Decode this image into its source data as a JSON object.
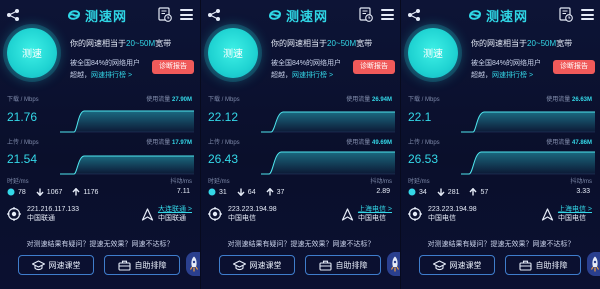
{
  "app": {
    "logo_text": "测速网",
    "brand_color": "#2fd7e6",
    "accent_red": "#f05a5a"
  },
  "common": {
    "start_label": "测速",
    "hero_prefix": "你的网速相当于",
    "hero_range": "20~50M",
    "hero_suffix": "宽带",
    "beat_text": "被全国84%的网络用户",
    "rank_prefix": "超越，",
    "rank_link": "网速排行榜 >",
    "report_label": "诊断报告",
    "download_label": "下载 / Mbps",
    "usage_label": "使用流量",
    "upload_label": "上传 / Mbps",
    "latency_label": "时延/ms",
    "jitter_label": "抖动/ms",
    "question_text": "对测速结果有疑问？提速无效果？网速不达标？",
    "course_label": "网速课堂",
    "fix_label": "自助排障"
  },
  "panels": [
    {
      "download": "21.76",
      "download_usage": "27.90M",
      "upload": "21.54",
      "upload_usage": "17.97M",
      "lat_a": "78",
      "lat_b": "1067",
      "lat_c": "1176",
      "jitter": "7.11",
      "ip": "221.216.117.133",
      "isp": "中国联通",
      "server": "大连联通 >",
      "server_isp": "中国联通"
    },
    {
      "download": "22.12",
      "download_usage": "26.94M",
      "upload": "26.43",
      "upload_usage": "49.69M",
      "lat_a": "31",
      "lat_b": "64",
      "lat_c": "37",
      "jitter": "2.89",
      "ip": "223.223.194.98",
      "isp": "中国电信",
      "server": "上海电信 >",
      "server_isp": "中国电信"
    },
    {
      "download": "22.1",
      "download_usage": "26.63M",
      "upload": "26.53",
      "upload_usage": "47.86M",
      "lat_a": "34",
      "lat_b": "281",
      "lat_c": "57",
      "jitter": "3.33",
      "ip": "223.223.194.98",
      "isp": "中国电信",
      "server": "上海电信 >",
      "server_isp": "中国电信"
    }
  ]
}
